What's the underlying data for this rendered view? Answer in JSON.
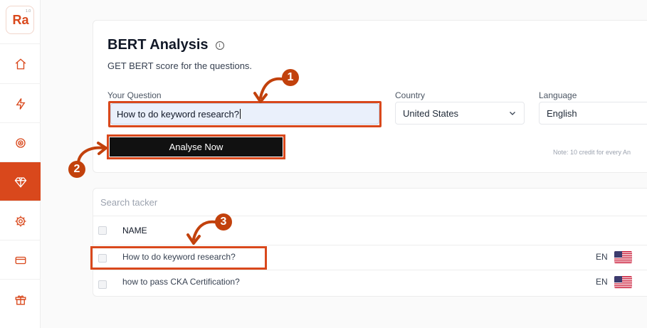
{
  "sidebar": {
    "logo_text": "Ra",
    "logo_version": "1.0",
    "items": [
      {
        "icon": "home-icon",
        "active": false
      },
      {
        "icon": "bolt-icon",
        "active": false
      },
      {
        "icon": "target-icon",
        "active": false
      },
      {
        "icon": "diamond-icon",
        "active": true
      },
      {
        "icon": "gear-icon",
        "active": false
      },
      {
        "icon": "card-icon",
        "active": false
      },
      {
        "icon": "gift-icon",
        "active": false
      }
    ]
  },
  "form": {
    "title": "BERT Analysis",
    "subtitle": "GET BERT score for the questions.",
    "question_label": "Your Question",
    "question_value": "How to do keyword research?",
    "country_label": "Country",
    "country_value": "United States",
    "language_label": "Language",
    "language_value": "English",
    "submit_label": "Analyse Now",
    "note": "Note: 10 credit for every An"
  },
  "table": {
    "search_placeholder": "Search tacker",
    "column_name": "NAME",
    "rows": [
      {
        "name": "How to do keyword research?",
        "lang": "EN"
      },
      {
        "name": "how to pass CKA Certification?",
        "lang": "EN"
      }
    ]
  },
  "annotations": [
    "1",
    "2",
    "3"
  ],
  "colors": {
    "accent": "#d9481c",
    "badge": "#c2410c",
    "button": "#111111"
  }
}
